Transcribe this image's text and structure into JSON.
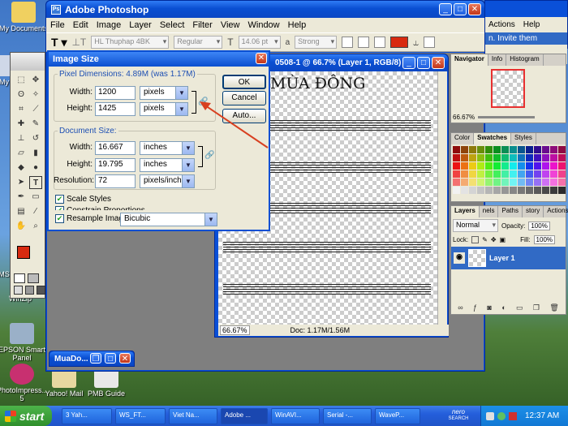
{
  "desktop_icons": [
    {
      "label": "My Documents",
      "name": "my-documents-icon"
    },
    {
      "label": "My",
      "name": "my-computer-icon"
    },
    {
      "label": "EPSON Smart Panel",
      "name": "epson-smart-panel-icon"
    },
    {
      "label": "PhotoImpress... 5",
      "name": "photoimpression-icon"
    },
    {
      "label": "Yahoo! Mail",
      "name": "yahoo-mail-icon"
    },
    {
      "label": "PMB Guide",
      "name": "pmb-guide-icon"
    },
    {
      "label": "MS",
      "name": "ms-icon"
    },
    {
      "label": "WinZip",
      "name": "winzip-icon"
    }
  ],
  "photoshop": {
    "title": "Adobe Photoshop",
    "menu": [
      "File",
      "Edit",
      "Image",
      "Layer",
      "Select",
      "Filter",
      "View",
      "Window",
      "Help"
    ],
    "options": {
      "font": "HL Thuphap 4BK",
      "style": "Regular",
      "size": "14.06 pt",
      "aa_label": "a",
      "aa": "Strong",
      "text_color": "#d82a10"
    }
  },
  "bg_window": {
    "menu": [
      "Actions",
      "Help"
    ],
    "invite": "n. Invite them"
  },
  "document": {
    "title": "0508-1 @ 66.7% (Layer 1, RGB/8)",
    "heading": "MÙA ĐÔNG",
    "zoom": "66.67%",
    "doc_info": "Doc: 1.17M/1.56M"
  },
  "dialog": {
    "title": "Image Size",
    "pixel_dimensions": "Pixel Dimensions: 4.89M (was 1.17M)",
    "px_width_label": "Width:",
    "px_width": "1200",
    "px_width_unit": "pixels",
    "px_height_label": "Height:",
    "px_height": "1425",
    "px_height_unit": "pixels",
    "document_size": "Document Size:",
    "doc_width_label": "Width:",
    "doc_width": "16.667",
    "doc_width_unit": "inches",
    "doc_height_label": "Height:",
    "doc_height": "19.795",
    "doc_height_unit": "inches",
    "resolution_label": "Resolution:",
    "resolution": "72",
    "resolution_unit": "pixels/inch",
    "scale_styles": "Scale Styles",
    "constrain": "Constrain Proportions",
    "resample_label": "Resample Image:",
    "resample": "Bicubic",
    "ok": "OK",
    "cancel": "Cancel",
    "auto": "Auto..."
  },
  "navigator": {
    "tabs": [
      "Navigator",
      "Info",
      "Histogram"
    ],
    "zoom": "66.67%"
  },
  "swatches": {
    "tabs": [
      "Color",
      "Swatches",
      "Styles"
    ]
  },
  "layers": {
    "tabs": [
      "Layers",
      "nels",
      "Paths",
      "story",
      "Actions"
    ],
    "blend_mode": "Normal",
    "opacity_label": "Opacity:",
    "opacity": "100%",
    "lock_label": "Lock:",
    "fill_label": "Fill:",
    "fill": "100%",
    "layer_name": "Layer 1"
  },
  "minimized": {
    "title": "MuaDo..."
  },
  "taskbar": {
    "start": "start",
    "items": [
      "3 Yah...",
      "WS_FT...",
      "Viet Na...",
      "Adobe ...",
      "WinAVI...",
      "Serial -...",
      "WaveP..."
    ],
    "tray_nero": "nero",
    "tray_nero_sub": "SEARCH",
    "clock": "12:37 AM"
  }
}
